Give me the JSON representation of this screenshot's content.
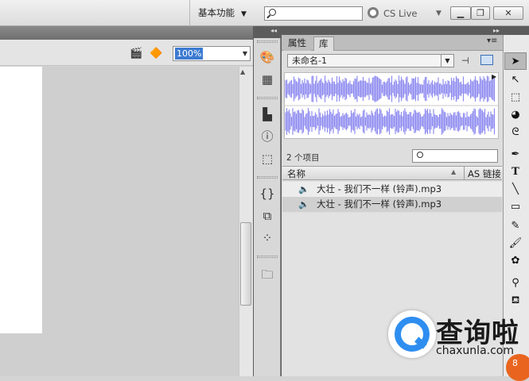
{
  "topbar": {
    "workspace_label": "基本功能",
    "search_placeholder": "",
    "cslive_label": "CS Live",
    "window_buttons": [
      "minimize",
      "restore",
      "close"
    ]
  },
  "doc_toolbar": {
    "zoom_value": "100%"
  },
  "panel": {
    "tabs": [
      {
        "label": "属性",
        "active": false
      },
      {
        "label": "库",
        "active": true
      }
    ],
    "document_select": "未命名-1",
    "item_count": "2 个项目",
    "columns": {
      "name": "名称",
      "link": "AS 链接"
    },
    "items": [
      {
        "name": "大壮 - 我们不一样 (铃声).mp3",
        "icon": "sound-icon"
      },
      {
        "name": "大壮 - 我们不一样 (铃声).mp3",
        "icon": "sound-icon"
      }
    ]
  },
  "dock_icons": [
    "color-palette-icon",
    "swatches-grid-icon",
    "align-icon",
    "info-icon",
    "transform-icon",
    "code-snippets-icon",
    "components-icon",
    "motion-presets-icon",
    "project-icon"
  ],
  "tools": [
    "selection-tool-icon",
    "subselection-tool-icon",
    "free-transform-tool-icon",
    "3d-rotation-tool-icon",
    "lasso-tool-icon",
    "pen-tool-icon",
    "text-tool-icon",
    "line-tool-icon",
    "rectangle-tool-icon",
    "pencil-tool-icon",
    "brush-tool-icon",
    "deco-tool-icon",
    "bone-tool-icon",
    "paint-bucket-tool-icon"
  ],
  "watermark": {
    "title": "查询啦",
    "url": "chaxunla.com",
    "badge": "8"
  },
  "colors": {
    "waveform": "#8f8cf0",
    "selection": "#3d7bd1",
    "watermark_blue": "#2e8ef0"
  }
}
